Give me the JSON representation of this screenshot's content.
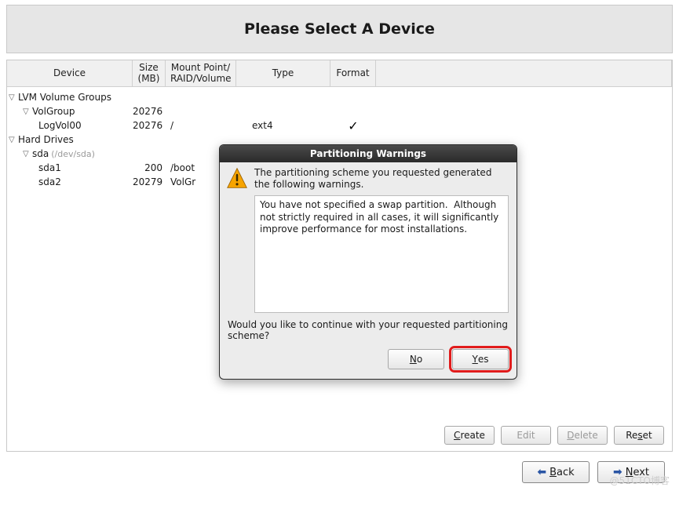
{
  "title": "Please Select A Device",
  "columns": {
    "device": "Device",
    "size_l1": "Size",
    "size_l2": "(MB)",
    "mount_l1": "Mount Point/",
    "mount_l2": "RAID/Volume",
    "type": "Type",
    "format": "Format"
  },
  "tree": {
    "lvm_group_header": "LVM Volume Groups",
    "volgroup": {
      "name": "VolGroup",
      "size": "20276"
    },
    "logvol": {
      "name": "LogVol00",
      "size": "20276",
      "mount": "/",
      "type": "ext4",
      "format_check": "✓"
    },
    "hard_drives_header": "Hard Drives",
    "sda": {
      "name": "sda",
      "hint": "(/dev/sda)"
    },
    "sda1": {
      "name": "sda1",
      "size": "200",
      "mount": "/boot"
    },
    "sda2": {
      "name": "sda2",
      "size": "20279",
      "mount": "VolGr"
    }
  },
  "actions": {
    "create": "Create",
    "edit": "Edit",
    "delete": "Delete",
    "reset": "Reset"
  },
  "nav": {
    "back": "Back",
    "next": "Next"
  },
  "dialog": {
    "title": "Partitioning Warnings",
    "message": "The partitioning scheme you requested generated the following warnings.",
    "warning_text": "You have not specified a swap partition.  Although not strictly required in all cases, it will significantly improve performance for most installations.",
    "question": "Would you like to continue with your requested partitioning scheme?",
    "no": "No",
    "yes": "Yes"
  },
  "watermark": "@51CTO博客"
}
